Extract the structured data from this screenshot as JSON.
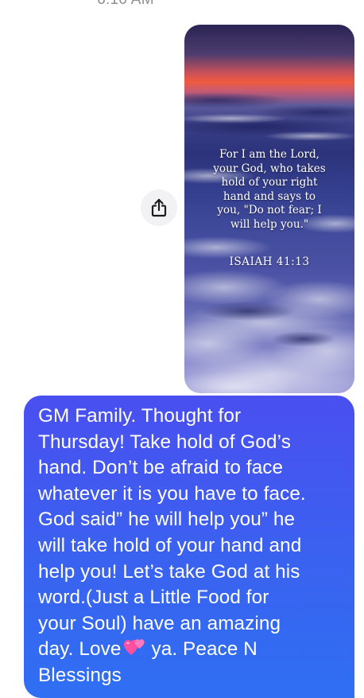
{
  "timestamp": "6:10 AM",
  "image_message": {
    "verse_lines": [
      "For I am the Lord,",
      "your God, who takes",
      "hold of your right",
      "hand and says to",
      "you, \"Do not fear; I",
      "will help you.\""
    ],
    "reference": "ISAIAH 41:13"
  },
  "text_message": {
    "lines": [
      "GM Family. Thought for",
      "Thursday! Take hold of God’s",
      "hand. Don’t be afraid to face",
      "whatever it is you have to face.",
      "God said” he will help you” he",
      "will take hold of your hand and",
      "help you! Let’s take God at his",
      "word.(Just a Little Food for",
      "your Soul) have an amazing"
    ],
    "love_prefix": "day. Love",
    "emoji": "💕",
    "love_suffix": "ya. Peace N",
    "last_line": "Blessings"
  },
  "colors": {
    "bubble_blue_top": "#4a4ff0",
    "bubble_blue_bottom": "#2f6ff3",
    "timestamp_gray": "#8e8e93"
  },
  "icons": {
    "share": "share-icon",
    "emoji": "two-hearts-icon"
  }
}
